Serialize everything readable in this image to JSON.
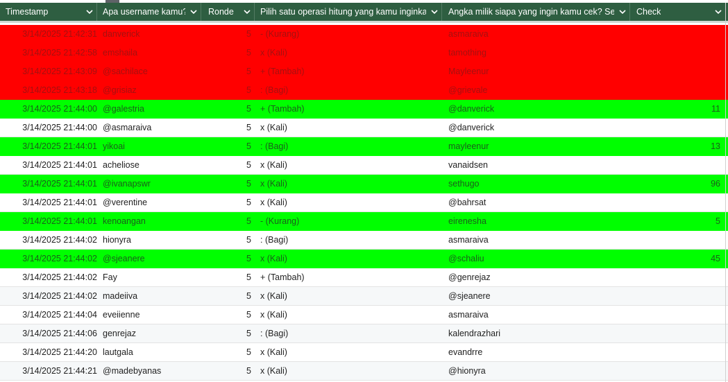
{
  "columns": [
    {
      "key": "timestamp",
      "label": "Timestamp"
    },
    {
      "key": "username",
      "label": "Apa username kamu?"
    },
    {
      "key": "ronde",
      "label": "Ronde"
    },
    {
      "key": "operasi",
      "label": "Pilih satu operasi hitung yang kamu inginkan."
    },
    {
      "key": "target",
      "label": "Angka milik siapa yang ingin kamu cek? Sebu"
    },
    {
      "key": "check",
      "label": "Check"
    }
  ],
  "colors": {
    "header_bg": "#2e5e41",
    "red": "#ff0000",
    "green": "#00ff00"
  },
  "rows": [
    {
      "timestamp": "3/14/2025 21:42:31",
      "username": "danverick",
      "ronde": "5",
      "operasi": "- (Kurang)",
      "target": "asmaraiva",
      "check": "",
      "status": "red"
    },
    {
      "timestamp": "3/14/2025 21:42:58",
      "username": "emshaila",
      "ronde": "5",
      "operasi": "x (Kali)",
      "target": "tamothing",
      "check": "",
      "status": "red"
    },
    {
      "timestamp": "3/14/2025 21:43:09",
      "username": "@sachilace",
      "ronde": "5",
      "operasi": "+ (Tambah)",
      "target": "Mayleenur",
      "check": "",
      "status": "red"
    },
    {
      "timestamp": "3/14/2025 21:43:18",
      "username": "@grisiaz",
      "ronde": "5",
      "operasi": ": (Bagi)",
      "target": "@grievale",
      "check": "",
      "status": "red"
    },
    {
      "timestamp": "3/14/2025 21:44:00",
      "username": "@galestria",
      "ronde": "5",
      "operasi": "+ (Tambah)",
      "target": "@danverick",
      "check": "11",
      "status": "green"
    },
    {
      "timestamp": "3/14/2025 21:44:00",
      "username": "@asmaraiva",
      "ronde": "5",
      "operasi": "x (Kali)",
      "target": "@danverick",
      "check": "",
      "status": "white"
    },
    {
      "timestamp": "3/14/2025 21:44:01",
      "username": "yikoai",
      "ronde": "5",
      "operasi": ": (Bagi)",
      "target": "mayleenur",
      "check": "13",
      "status": "green"
    },
    {
      "timestamp": "3/14/2025 21:44:01",
      "username": "acheliose",
      "ronde": "5",
      "operasi": "x (Kali)",
      "target": "vanaidsen",
      "check": "",
      "status": "white"
    },
    {
      "timestamp": "3/14/2025 21:44:01",
      "username": "@ivanapswr",
      "ronde": "5",
      "operasi": "x (Kali)",
      "target": "sethugo",
      "check": "96",
      "status": "green"
    },
    {
      "timestamp": "3/14/2025 21:44:01",
      "username": "@verentine",
      "ronde": "5",
      "operasi": "x (Kali)",
      "target": "@bahrsat",
      "check": "",
      "status": "white"
    },
    {
      "timestamp": "3/14/2025 21:44:01",
      "username": "kenoangan",
      "ronde": "5",
      "operasi": "- (Kurang)",
      "target": "eirenesha",
      "check": "5",
      "status": "green"
    },
    {
      "timestamp": "3/14/2025 21:44:02",
      "username": "hionyra",
      "ronde": "5",
      "operasi": ": (Bagi)",
      "target": "asmaraiva",
      "check": "",
      "status": "white"
    },
    {
      "timestamp": "3/14/2025 21:44:02",
      "username": "@sjeanere",
      "ronde": "5",
      "operasi": "x (Kali)",
      "target": "@schaliu",
      "check": "45",
      "status": "green"
    },
    {
      "timestamp": "3/14/2025 21:44:02",
      "username": "Fay",
      "ronde": "5",
      "operasi": "+ (Tambah)",
      "target": "@genrejaz",
      "check": "",
      "status": "white"
    },
    {
      "timestamp": "3/14/2025 21:44:02",
      "username": "madeiiva",
      "ronde": "5",
      "operasi": "x (Kali)",
      "target": "@sjeanere",
      "check": "",
      "status": "alt"
    },
    {
      "timestamp": "3/14/2025 21:44:04",
      "username": "eveiienne",
      "ronde": "5",
      "operasi": "x (Kali)",
      "target": "asmaraiva",
      "check": "",
      "status": "white"
    },
    {
      "timestamp": "3/14/2025 21:44:06",
      "username": "genrejaz",
      "ronde": "5",
      "operasi": ": (Bagi)",
      "target": "kalendrazhari",
      "check": "",
      "status": "alt"
    },
    {
      "timestamp": "3/14/2025 21:44:20",
      "username": "lautgala",
      "ronde": "5",
      "operasi": "x (Kali)",
      "target": "evandrre",
      "check": "",
      "status": "white"
    },
    {
      "timestamp": "3/14/2025 21:44:21",
      "username": "@madebyanas",
      "ronde": "5",
      "operasi": "x (Kali)",
      "target": "@hionyra",
      "check": "",
      "status": "alt"
    }
  ]
}
